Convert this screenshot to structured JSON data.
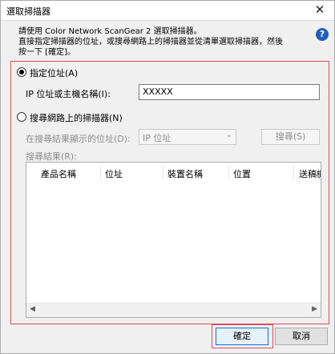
{
  "window": {
    "title": "選取掃描器"
  },
  "intro": {
    "line1": "請使用 Color Network ScanGear 2 選取掃描器。",
    "line2": "直接指定掃描器的位址，或搜尋網路上的掃描器並從清單選取掃描器，然後",
    "line3": "按一下 [確定]。"
  },
  "specify": {
    "radio_label": "指定位址(A)",
    "field_label": "IP 位址或主機名稱(I):",
    "field_value": "XXXXX"
  },
  "search": {
    "radio_label": "搜尋網路上的掃描器(N)",
    "display_label": "在搜尋結果顯示的位址(D):",
    "display_value": "IP 位址",
    "search_button": "搜尋(S)",
    "results_label": "搜尋結果(R):"
  },
  "results_table": {
    "columns": [
      "產品名稱",
      "位址",
      "裝置名稱",
      "位置",
      "送稿機"
    ]
  },
  "footer": {
    "ok": "確定",
    "cancel": "取消"
  }
}
